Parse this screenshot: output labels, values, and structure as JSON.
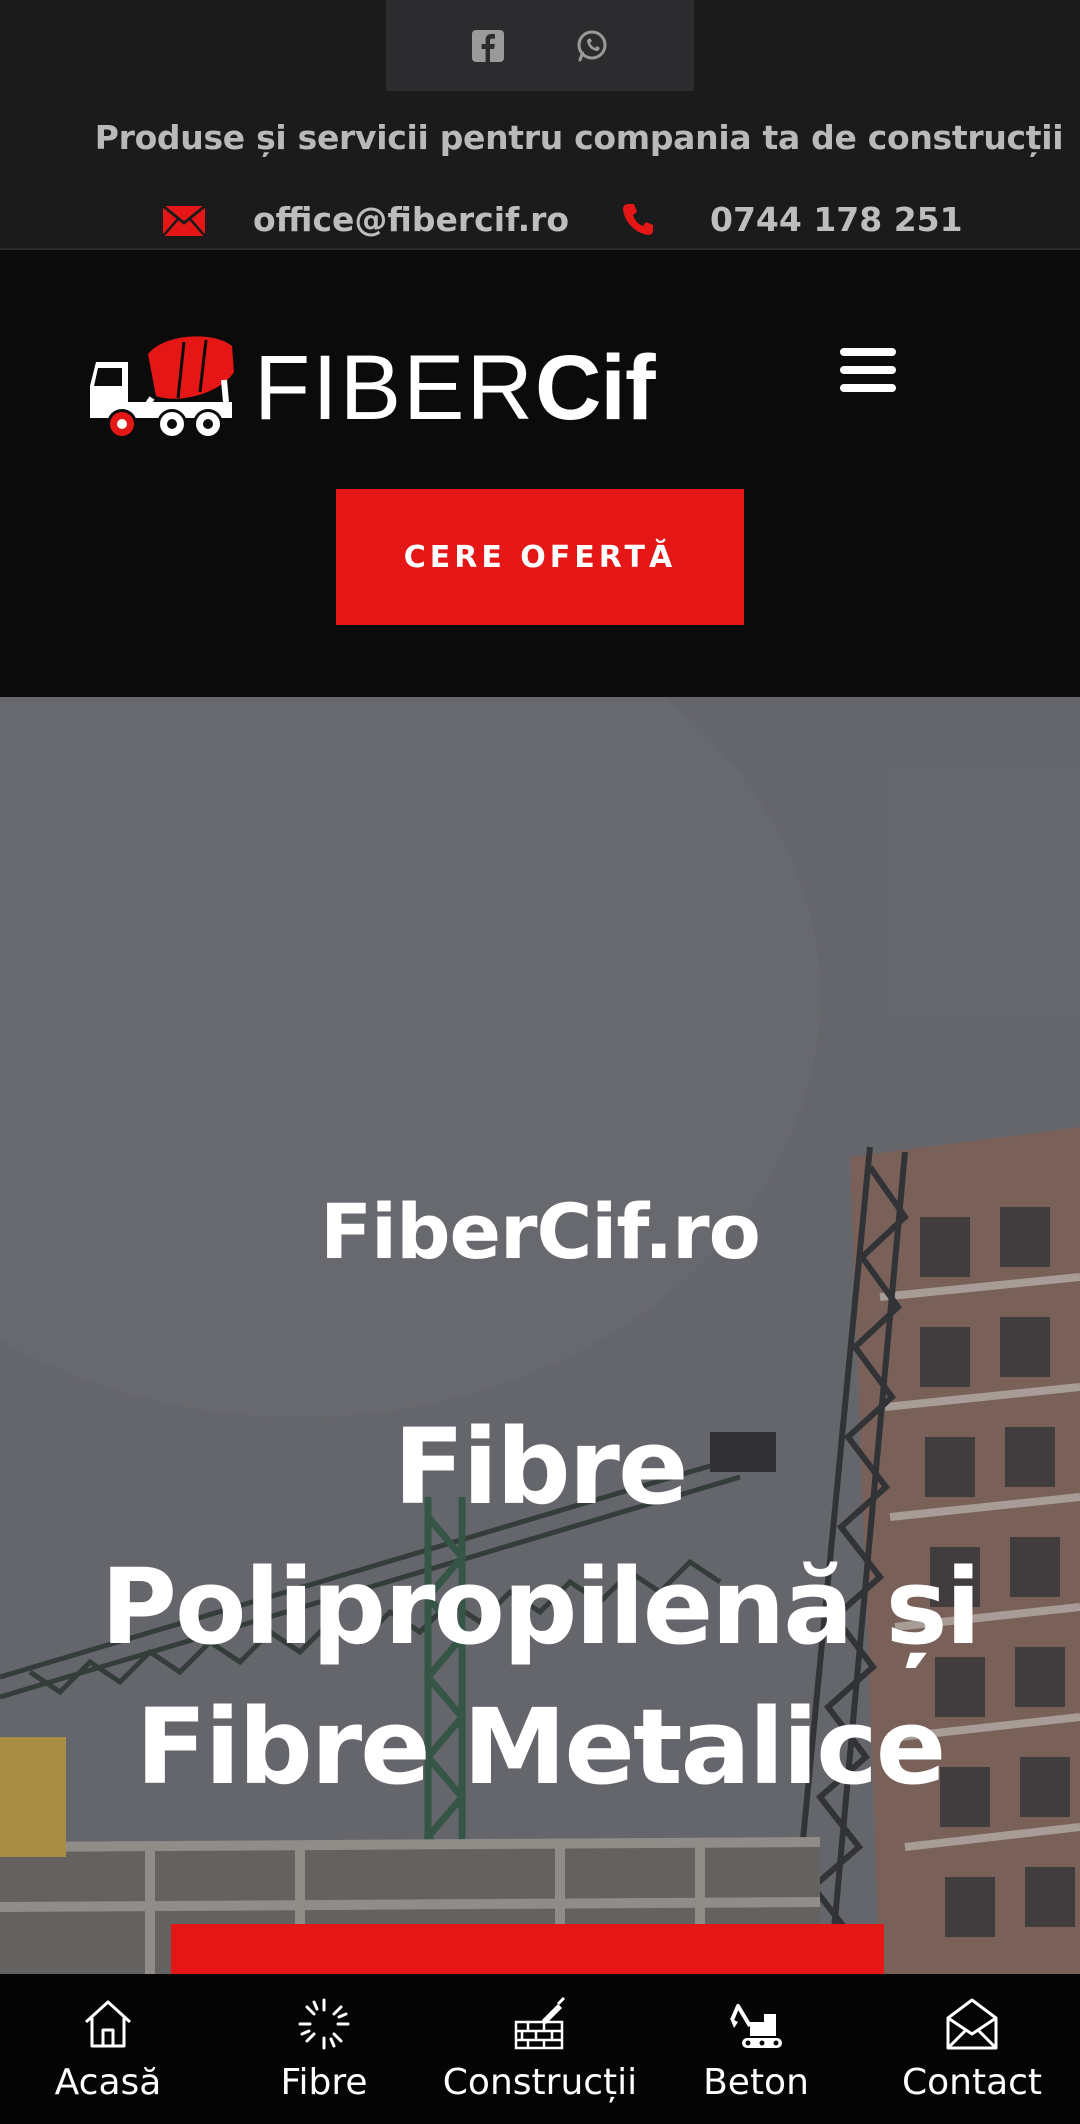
{
  "topbar": {
    "social": [
      {
        "name": "facebook",
        "icon": "facebook-icon"
      },
      {
        "name": "whatsapp",
        "icon": "whatsapp-icon"
      }
    ],
    "tagline": "Produse și servicii pentru compania ta de construcții",
    "email": "office@fibercif.ro",
    "phone": "0744 178 251",
    "icon_color": "#e41616"
  },
  "header": {
    "logo_thin": "FIBER",
    "logo_bold": "Cif",
    "cta_label": "CERE OFERTĂ",
    "accent": "#e41616"
  },
  "hero": {
    "subtitle": "FiberCif.ro",
    "title_line1": "Fibre",
    "title_line2": "Polipropilenă și",
    "title_line3": "Fibre Metalice"
  },
  "bottom_nav": [
    {
      "label": "Acasă",
      "icon": "home-icon"
    },
    {
      "label": "Fibre",
      "icon": "fibers-icon"
    },
    {
      "label": "Construcții",
      "icon": "bricks-icon"
    },
    {
      "label": "Beton",
      "icon": "excavator-icon"
    },
    {
      "label": "Contact",
      "icon": "envelope-icon"
    }
  ]
}
